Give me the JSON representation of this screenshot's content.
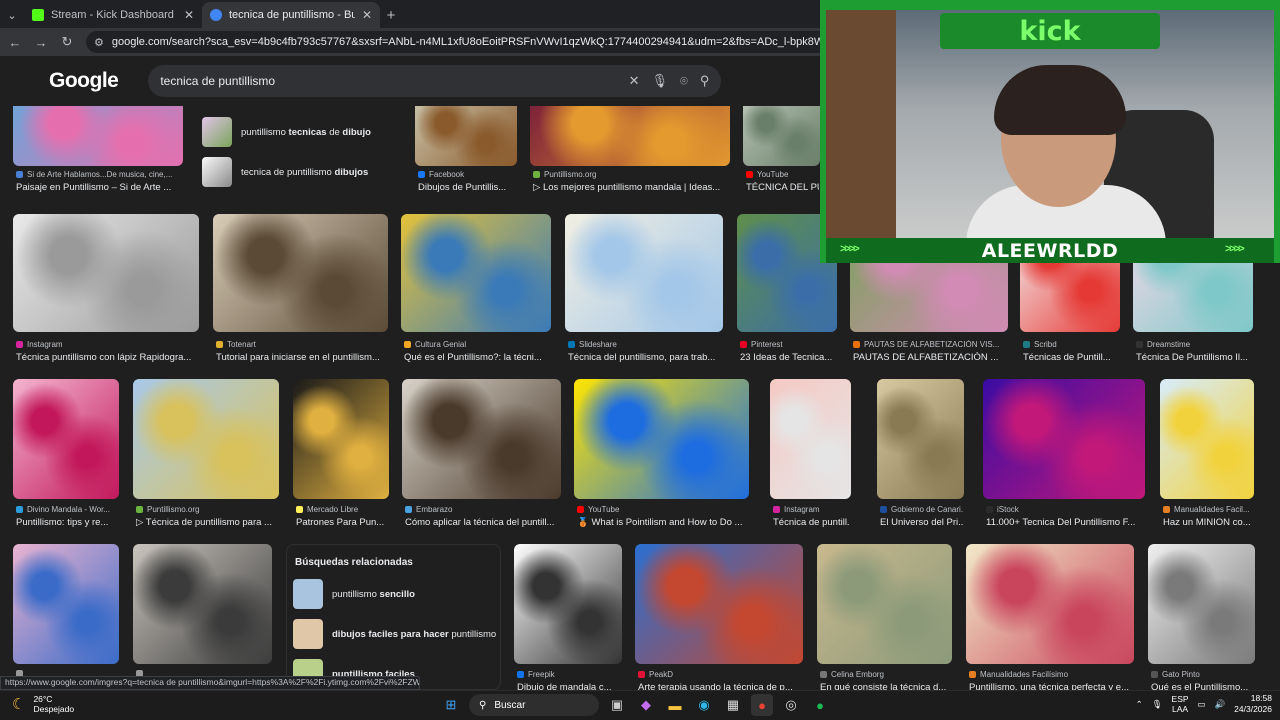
{
  "browser": {
    "tabs": [
      {
        "title": "Stream - Kick Dashboard",
        "favicon_color": "#53fc18",
        "active": false
      },
      {
        "title": "tecnica de puntillismo - Buscar",
        "favicon_color": "#4285f4",
        "active": true
      }
    ],
    "url": "google.com/search?sca_esv=4b9c4fb793c57767&sxsrf=ANbL-n4ML1xfU8oEoitPRSFnVWvI1qzWkQ:1774400294941&udm=2&fbs=ADc_l-bpk8W4E-qsVlOvbGJcDwpn60DcZd"
  },
  "google": {
    "logo": "Google",
    "query": "tecnica de puntillismo"
  },
  "suggestions_top": [
    {
      "pre": "puntillismo ",
      "bold": "tecnicas",
      "mid": " de ",
      "bold2": "dibujo"
    },
    {
      "pre": "tecnica de puntillismo ",
      "bold": "dibujos",
      "mid": "",
      "bold2": ""
    }
  ],
  "results_row0": [
    {
      "source": "Si de Arte Hablamos...De musica, cine,...",
      "title": "Paisaje en Puntillismo – Si de Arte ...",
      "color1": "#6ea5d9",
      "color2": "#e56fae",
      "src_color": "#4a7fd6"
    },
    {
      "source": "Facebook",
      "title": "Dibujos de Puntillis...",
      "color1": "#c9c2a8",
      "color2": "#8a5a2c",
      "src_color": "#1877f2"
    },
    {
      "source": "Puntillismo.org",
      "title": "▷ Los mejores puntillismo mandala | Ideas...",
      "color1": "#7b1e3a",
      "color2": "#e49a2f",
      "src_color": "#6db33f"
    },
    {
      "source": "YouTube",
      "title": "TÉCNICA DEL PU",
      "color1": "#b8c4b4",
      "color2": "#6a7f6a",
      "src_color": "#ff0000"
    }
  ],
  "results_row1": [
    {
      "source": "Instagram",
      "title": "Técnica puntillismo con lápiz Rapidogra...",
      "color1": "#e9e9e9",
      "color2": "#9a9a9a",
      "src_color": "#d6249f"
    },
    {
      "source": "Totenart",
      "title": "Tutorial para iniciarse en el puntillism...",
      "color1": "#d9cdb8",
      "color2": "#5a4a36",
      "src_color": "#e0b12f"
    },
    {
      "source": "Cultura Genial",
      "title": "Qué es el Puntillismo?: la técni...",
      "color1": "#e3c23a",
      "color2": "#3a7ab8",
      "src_color": "#f5a623"
    },
    {
      "source": "Slideshare",
      "title": "Técnica del puntillismo, para trab...",
      "color1": "#f2efe3",
      "color2": "#a3c7e8",
      "src_color": "#0077b5"
    },
    {
      "source": "Pinterest",
      "title": "23 Ideas de Tecnica...",
      "color1": "#5f8f4a",
      "color2": "#3b6ea8",
      "src_color": "#e60023"
    },
    {
      "source": "PAUTAS DE ALFABETIZACIÓN VIS...",
      "title": "PAUTAS DE ALFABETIZACIÓN ...",
      "color1": "#7aa25a",
      "color2": "#d28bb5",
      "src_color": "#e8710a"
    },
    {
      "source": "Scribd",
      "title": "Técnicas de Puntill...",
      "color1": "#f4f4f4",
      "color2": "#e53935",
      "src_color": "#1e7b85"
    },
    {
      "source": "Dreamstime",
      "title": "Técnica De Puntillismo Il...",
      "color1": "#f3d9e8",
      "color2": "#7ec8c9",
      "src_color": "#333333"
    }
  ],
  "results_row2": [
    {
      "source": "Divino Mandala - Wor...",
      "title": "Puntillismo: tips y re...",
      "color1": "#f3b4cf",
      "color2": "#c2185b",
      "src_color": "#2d9cdb"
    },
    {
      "source": "Puntillismo.org",
      "title": "▷ Técnica de puntillismo para ...",
      "color1": "#a9c9e8",
      "color2": "#d9c25b",
      "src_color": "#6db33f"
    },
    {
      "source": "Mercado Libre",
      "title": "Patrones Para Pun...",
      "color1": "#1a1a1a",
      "color2": "#e0b040",
      "src_color": "#fff159"
    },
    {
      "source": "Embarazo",
      "title": "Cómo aplicar la técnica del puntill...",
      "color1": "#d8d2c8",
      "color2": "#4a3a2c",
      "src_color": "#4aa3df"
    },
    {
      "source": "YouTube",
      "title": "🥉 What is Pointilism and How to Do ...",
      "color1": "#ffe600",
      "color2": "#1e6de0",
      "src_color": "#ff0000"
    },
    {
      "source": "Instagram",
      "title": "Técnica de puntill...",
      "color1": "#f5c9c4",
      "color2": "#e5e5e5",
      "src_color": "#d6249f"
    },
    {
      "source": "Gobierno de Canari...",
      "title": "El Universo del Pri...",
      "color1": "#d9c9a2",
      "color2": "#8a7a54",
      "src_color": "#1f4e9c"
    },
    {
      "source": "iStock",
      "title": "11.000+ Tecnica Del Puntillismo F...",
      "color1": "#3a0ca3",
      "color2": "#c2187a",
      "src_color": "#2b2b2b"
    },
    {
      "source": "Manualidades Facil...",
      "title": "Haz un MINION co...",
      "color1": "#d8ecfa",
      "color2": "#f2d23c",
      "src_color": "#e67e22"
    }
  ],
  "results_row3": [
    {
      "source": "",
      "title": "",
      "color1": "#e9b3d0",
      "color2": "#3a6bc8",
      "src_color": "#999999"
    },
    {
      "source": "",
      "title": "",
      "color1": "#c9c4bd",
      "color2": "#3b3b3b",
      "src_color": "#999999"
    },
    {
      "source": "Freepik",
      "title": "Dibujo de mandala c...",
      "color1": "#ffffff",
      "color2": "#333333",
      "src_color": "#1273eb"
    },
    {
      "source": "PeakD",
      "title": "Arte terapia usando la técnica de p...",
      "color1": "#2a6fd1",
      "color2": "#c4472f",
      "src_color": "#e31337"
    },
    {
      "source": "Celina Emborg",
      "title": "En qué consiste la técnica d...",
      "color1": "#c9b98e",
      "color2": "#8c9a7a",
      "src_color": "#777777"
    },
    {
      "source": "Manualidades Facilísimo",
      "title": "Puntillismo, una técnica perfecta y e...",
      "color1": "#f2e9c8",
      "color2": "#c9455c",
      "src_color": "#e67e22"
    },
    {
      "source": "Gato Pinto",
      "title": "Qué es el Puntillismo...",
      "color1": "#efefef",
      "color2": "#7a7a7a",
      "src_color": "#555555"
    }
  ],
  "related": {
    "heading": "Búsquedas relacionadas",
    "items": [
      {
        "pre": "puntillismo ",
        "bold": "sencillo",
        "color": "#a9c4de"
      },
      {
        "pre": "",
        "bold": "dibujos faciles para hacer",
        "post": " puntillismo",
        "color": "#e0c7a8"
      },
      {
        "pre": "",
        "bold": "puntillismo faciles",
        "color": "#b9d08a"
      }
    ]
  },
  "stream_overlay": {
    "platform": "kick",
    "streamer": "ALEEWRLDD"
  },
  "statusbar_url": "https://www.google.com/imgres?q=tecnica de puntillismo&imgurl=https%3A%2F%2Fi.ytimg.com%2Fvi%2FZWT7w...",
  "taskbar": {
    "weather_temp": "26°C",
    "weather_desc": "Despejado",
    "search_placeholder": "Buscar",
    "lang_line1": "ESP",
    "lang_line2": "LAA",
    "time": "18:58",
    "date": "24/3/2026"
  }
}
